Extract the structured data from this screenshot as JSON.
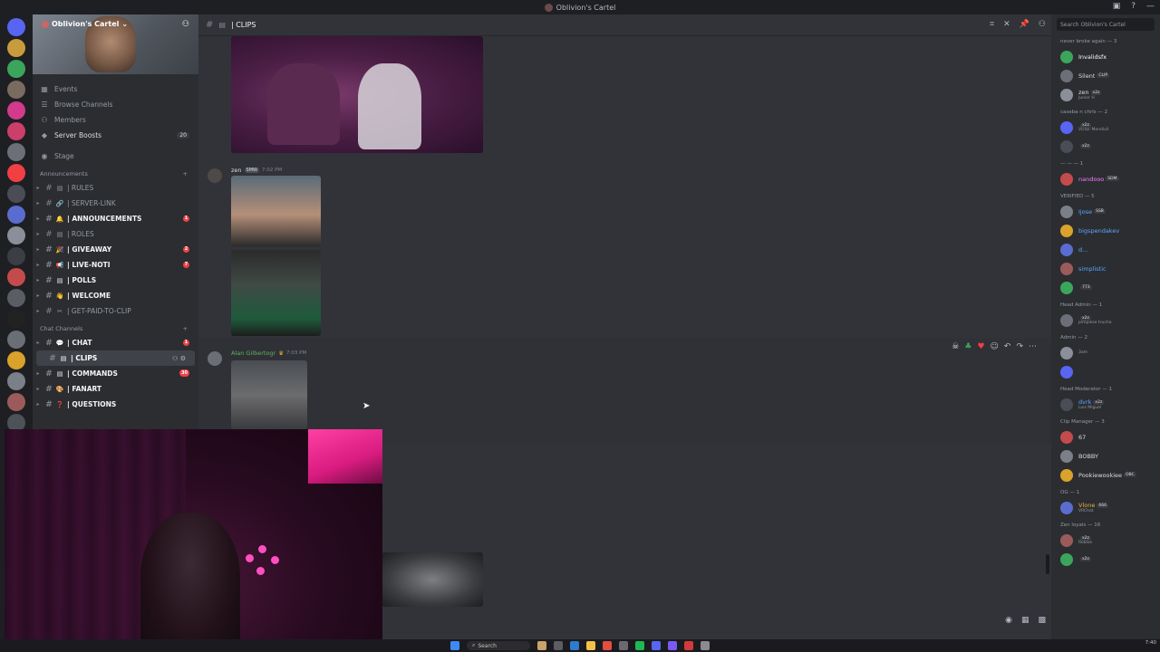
{
  "window": {
    "title": "Oblivion's Cartel"
  },
  "server": {
    "name": "Oblivion's Cartel",
    "nav": [
      {
        "label": "Events"
      },
      {
        "label": "Browse Channels"
      },
      {
        "label": "Members"
      },
      {
        "label": "Server Boosts",
        "count": "20"
      }
    ],
    "stage_label": "Stage",
    "categories": [
      {
        "name": "Announcements",
        "channels": [
          {
            "emoji": "▤",
            "label": "| RULES",
            "bold": false
          },
          {
            "emoji": "🔗",
            "label": "| SERVER-LINK",
            "bold": false
          },
          {
            "emoji": "🔔",
            "label": "| ANNOUNCEMENTS",
            "bold": true,
            "badge": "1"
          },
          {
            "emoji": "▤",
            "label": "| ROLES",
            "bold": false
          },
          {
            "emoji": "🎉",
            "label": "| GIVEAWAY",
            "bold": true,
            "badge": "2"
          },
          {
            "emoji": "📢",
            "label": "| LIVE-NOTI",
            "bold": true,
            "badge": "7"
          },
          {
            "emoji": "▤",
            "label": "| POLLS",
            "bold": true
          },
          {
            "emoji": "👋",
            "label": "| WELCOME",
            "bold": true
          },
          {
            "emoji": "✂",
            "label": "| GET-PAID-TO-CLIP",
            "bold": false
          }
        ]
      },
      {
        "name": "Chat Channels",
        "channels": [
          {
            "emoji": "💬",
            "label": "| CHAT",
            "bold": true,
            "badge": "1"
          },
          {
            "emoji": "▤",
            "label": "| CLIPS",
            "bold": true,
            "active": true
          },
          {
            "emoji": "▤",
            "label": "| COMMANDS",
            "bold": true,
            "badge": "30"
          },
          {
            "emoji": "🎨",
            "label": "| FANART",
            "bold": true
          },
          {
            "emoji": "❓",
            "label": "| QUESTIONS",
            "bold": true
          }
        ]
      }
    ]
  },
  "channel": {
    "name": "| CLIPS",
    "search_placeholder": "Search Oblivion's Cartel"
  },
  "messages": [
    {
      "author": "zen",
      "tag": "SMW",
      "time": "7:02 PM"
    },
    {
      "author": "Alan Gilbertogr",
      "time": "7:03 PM"
    }
  ],
  "members": {
    "groups": [
      {
        "title": "never broke again — 3",
        "items": [
          {
            "name": "Invalidsfx",
            "color": "#ffffff",
            "tag": ""
          },
          {
            "name": "Silent",
            "color": "#dbdee1",
            "tag": "CLIP"
          },
          {
            "name": "zen",
            "color": "#dbdee1",
            "tag": "x2z",
            "sub": "Junior H"
          }
        ]
      },
      {
        "title": "caseba n chris — 2",
        "items": [
          {
            "name": "",
            "color": "#dbdee1",
            "tag": "x2z",
            "sub": "Victor Mendivil"
          },
          {
            "name": "",
            "color": "#dbdee1",
            "tag": "x2z"
          }
        ]
      },
      {
        "title": "— — — 1",
        "items": [
          {
            "name": "nandooo",
            "color": "#f47fff",
            "tag": "SDM"
          }
        ]
      },
      {
        "title": "VERIFIED — 5",
        "items": [
          {
            "name": "Ijose",
            "color": "#5aa9ff",
            "tag": "SSB"
          },
          {
            "name": "bigspendakev",
            "color": "#5aa9ff",
            "tag": ""
          },
          {
            "name": "d...",
            "color": "#5aa9ff",
            "tag": ""
          },
          {
            "name": "simplistic",
            "color": "#5aa9ff",
            "tag": ""
          },
          {
            "name": "",
            "color": "#dbdee1",
            "tag": "773"
          }
        ]
      },
      {
        "title": "Head Admin — 1",
        "items": [
          {
            "name": "",
            "color": "#f23f43",
            "tag": "x2z",
            "sub": "pimpiese trucha"
          }
        ]
      },
      {
        "title": "Admin — 2",
        "items": [
          {
            "name": "",
            "color": "#f47fff",
            "tag": "",
            "sub": "3am"
          },
          {
            "name": "",
            "color": "#f47fff",
            "tag": ""
          }
        ]
      },
      {
        "title": "Head Moderator — 1",
        "items": [
          {
            "name": "dvrk",
            "color": "#5aa9ff",
            "tag": "x2z",
            "sub": "Luis Miguel"
          }
        ]
      },
      {
        "title": "Clip Manager — 3",
        "items": [
          {
            "name": "67",
            "color": "#dbdee1",
            "tag": ""
          },
          {
            "name": "BOBBY",
            "color": "#dbdee1",
            "tag": ""
          },
          {
            "name": "Pookiewookiee",
            "color": "#dbdee1",
            "tag": "OBC"
          }
        ]
      },
      {
        "title": "OG — 1",
        "items": [
          {
            "name": "Vlone",
            "color": "#f0b232",
            "tag": "666",
            "sub": "VRChat"
          }
        ]
      },
      {
        "title": "Zen loyals — 16",
        "items": [
          {
            "name": "",
            "color": "#dbdee1",
            "tag": "x2z",
            "sub": "Roblox"
          },
          {
            "name": "",
            "color": "#dbdee1",
            "tag": "x2z"
          }
        ]
      }
    ]
  },
  "taskbar": {
    "search_label": "Search",
    "time": "7:40"
  },
  "colors": {
    "rail": "#1e1f22",
    "sidebar": "#2b2d31",
    "main": "#313338",
    "accent_red": "#f23f43"
  }
}
